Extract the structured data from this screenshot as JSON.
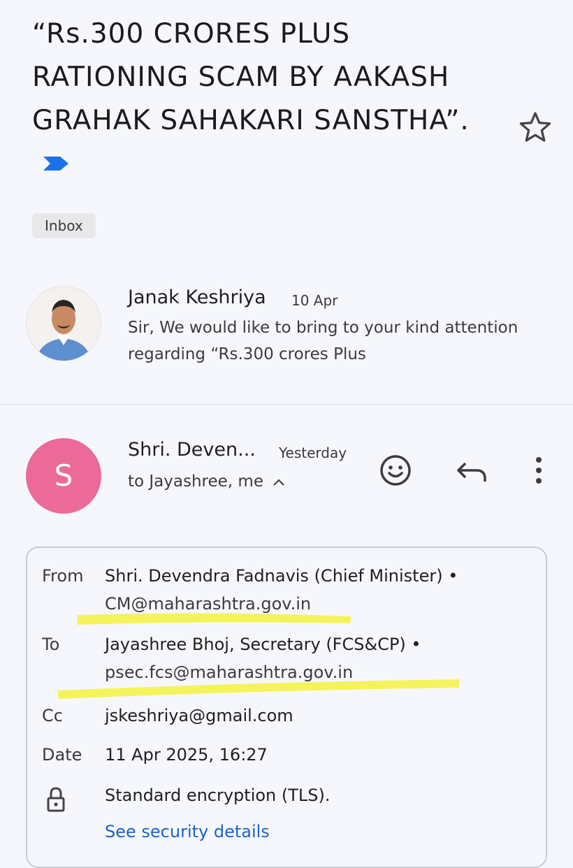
{
  "email": {
    "subject": "“Rs.300 CRORES PLUS RATIONING SCAM BY AAKASH GRAHAK SAHAKARI SANSTHA”.",
    "label": "Inbox",
    "icons": {
      "important": "important-marker-icon",
      "star": "star-outline-icon"
    },
    "colors": {
      "important": "#1a73e8",
      "avatar_s": "#ec6a97",
      "highlight": "#f5f24a",
      "link": "#1a63c9"
    }
  },
  "previous_message": {
    "sender": "Janak Keshriya",
    "date": "10 Apr",
    "snippet": "Sir, We would like to bring to your kind attention regarding “Rs.300 crores Plus"
  },
  "current_message": {
    "avatar_letter": "S",
    "sender": "Shri. Deven...",
    "date": "Yesterday",
    "recipients": "to Jayashree, me",
    "actions": [
      "emoji-react-icon",
      "reply-icon",
      "more-vert-icon"
    ]
  },
  "details": {
    "from_label": "From",
    "from_name": "Shri. Devendra Fadnavis (Chief Minister) •",
    "from_email": "CM@maharashtra.gov.in",
    "to_label": "To",
    "to_name": "Jayashree Bhoj, Secretary (FCS&CP) •",
    "to_email": "psec.fcs@maharashtra.gov.in",
    "cc_label": "Cc",
    "cc_value": "jskeshriya@gmail.com",
    "date_label": "Date",
    "date_value": "11 Apr 2025, 16:27",
    "security_value": "Standard encryption (TLS).",
    "security_link": "See security details"
  }
}
